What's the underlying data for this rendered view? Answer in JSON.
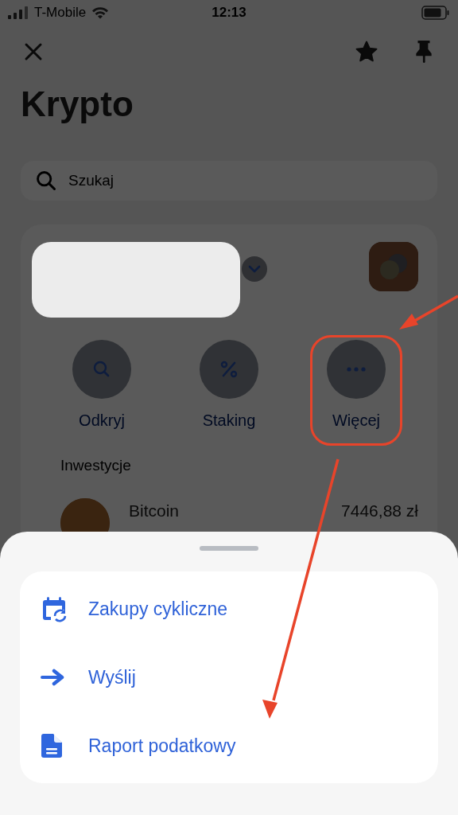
{
  "status_bar": {
    "carrier": "T-Mobile",
    "time": "12:13"
  },
  "title": "Krypto",
  "search": {
    "placeholder": "Szukaj"
  },
  "actions": [
    {
      "label": "Odkryj",
      "kind": "search",
      "highlighted": false
    },
    {
      "label": "Staking",
      "kind": "percent",
      "highlighted": false
    },
    {
      "label": "Więcej",
      "kind": "more",
      "highlighted": true
    }
  ],
  "section_title": "Inwestycje",
  "holdings": [
    {
      "name": "Bitcoin",
      "value": "7446,88 zł"
    }
  ],
  "sheet": {
    "items": [
      {
        "label": "Zakupy cykliczne",
        "kind": "recurring"
      },
      {
        "label": "Wyślij",
        "kind": "send"
      },
      {
        "label": "Raport podatkowy",
        "kind": "report"
      }
    ]
  }
}
